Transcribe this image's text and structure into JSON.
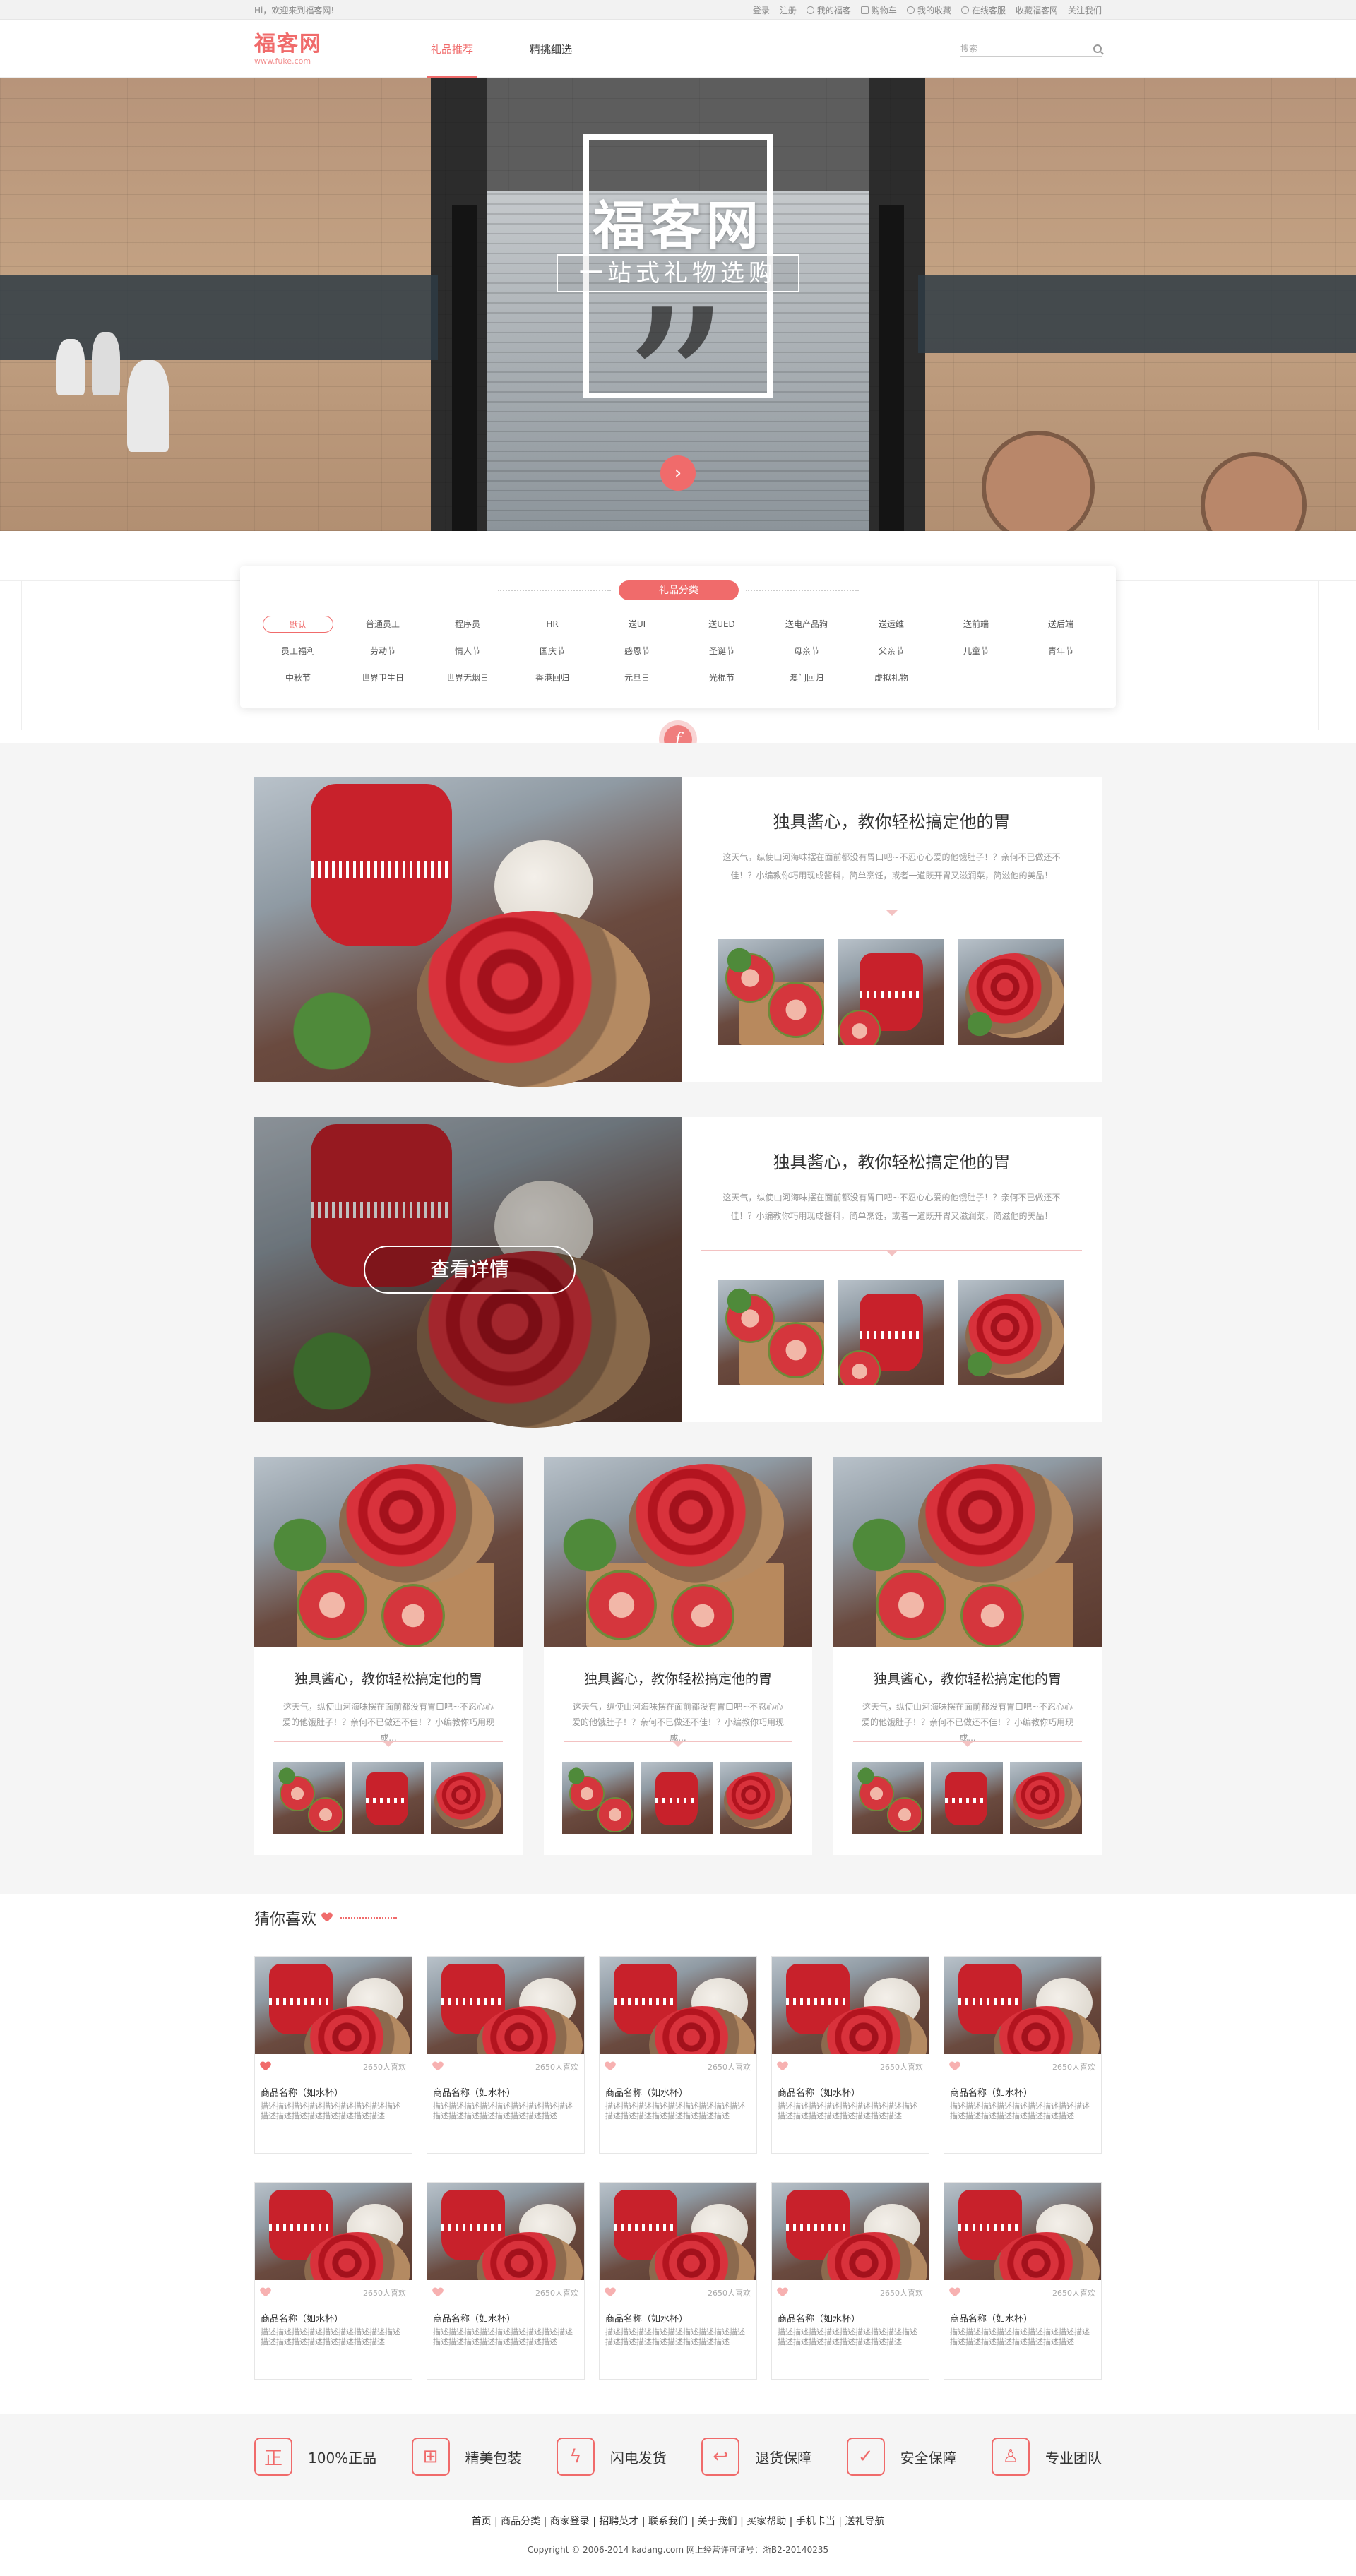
{
  "topbar": {
    "greeting": "Hi，欢迎来到福客网!",
    "links": [
      "登录",
      "注册",
      "我的福客",
      "购物车",
      "我的收藏",
      "在线客服",
      "收藏福客网",
      "关注我们"
    ]
  },
  "header": {
    "logo_cn": "福客网",
    "logo_en": "www.fuke.com",
    "nav": [
      "礼品推荐",
      "精挑细选"
    ],
    "search_placeholder": "搜索"
  },
  "banner": {
    "title": "福客网",
    "subtitle": "一站式礼物选购",
    "slides": 4,
    "active_slide": 1
  },
  "categories": {
    "title": "礼品分类",
    "tags": [
      "默认",
      "普通员工",
      "程序员",
      "HR",
      "送UI",
      "送UED",
      "送电产品狗",
      "送运维",
      "送前端",
      "送后端",
      "员工福利",
      "劳动节",
      "情人节",
      "国庆节",
      "感恩节",
      "圣诞节",
      "母亲节",
      "父亲节",
      "儿童节",
      "青年节",
      "中秋节",
      "世界卫生日",
      "世界无烟日",
      "香港回归",
      "元旦日",
      "光棍节",
      "澳门回归",
      "虚拟礼物"
    ]
  },
  "features": [
    {
      "title": "独具酱心，教你轻松搞定他的胃",
      "desc": "这天气，纵使山河海味摆在面前都没有胃口吧~不忍心心爱的他饿肚子！？亲何不已做还不佳！？小编教你巧用现成酱料，简单烹饪，或者一道既开胃又滋润菜，简滋他的美品！"
    },
    {
      "title": "独具酱心，教你轻松搞定他的胃",
      "desc": "这天气，纵使山河海味摆在面前都没有胃口吧~不忍心心爱的他饿肚子！？亲何不已做还不佳！？小编教你巧用现成酱料，简单烹饪，或者一道既开胃又滋润菜，简滋他的美品！",
      "button": "查看详情"
    }
  ],
  "cards": [
    {
      "title": "独具酱心，教你轻松搞定他的胃",
      "desc": "这天气，纵使山河海味摆在面前都没有胃口吧~不忍心心爱的他饿肚子！？亲何不已做还不佳！？小编教你巧用现成..."
    },
    {
      "title": "独具酱心，教你轻松搞定他的胃",
      "desc": "这天气，纵使山河海味摆在面前都没有胃口吧~不忍心心爱的他饿肚子！？亲何不已做还不佳！？小编教你巧用现成..."
    },
    {
      "title": "独具酱心，教你轻松搞定他的胃",
      "desc": "这天气，纵使山河海味摆在面前都没有胃口吧~不忍心心爱的他饿肚子！？亲何不已做还不佳！？小编教你巧用现成..."
    }
  ],
  "recommend": {
    "title": "猜你喜欢",
    "product": {
      "likes": "2650人喜欢",
      "name": "商品名称（如水杯）",
      "desc": "描述描述描述描述描述描述描述描述描述描述描述描述描述描述描述描述描述"
    }
  },
  "services": [
    "100%正品",
    "精美包装",
    "闪电发货",
    "退货保障",
    "安全保障",
    "专业团队"
  ],
  "footer": {
    "links": "首页 | 商品分类 | 商家登录 | 招聘英才 | 联系我们 | 关于我们 | 买家帮助 | 手机卡当 | 送礼导航",
    "copy": "Copyright © 2006-2014 kadang.com 网上经营许可证号：浙B2-20140235"
  },
  "colors": {
    "accent": "#f06b6b",
    "gray_bg": "#f5f5f5"
  }
}
